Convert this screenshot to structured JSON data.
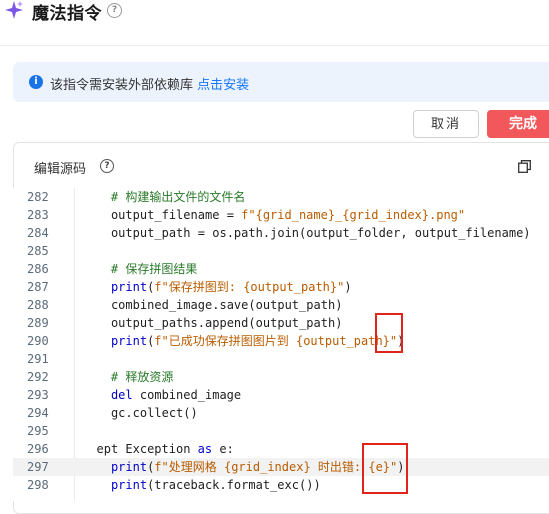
{
  "header": {
    "title": "魔法指令",
    "help": "?"
  },
  "banner": {
    "text": "该指令需安装外部依赖库",
    "link": "点击安装",
    "icon": "i"
  },
  "buttons": {
    "cancel": "取消",
    "done": "完成"
  },
  "editor": {
    "title": "编辑源码",
    "help": "?"
  },
  "code_lines": [
    {
      "n": "282",
      "text": "    # 构建输出文件的文件名"
    },
    {
      "n": "283",
      "text": "    output_filename = f\"{grid_name}_{grid_index}.png\""
    },
    {
      "n": "284",
      "text": "    output_path = os.path.join(output_folder, output_filename)"
    },
    {
      "n": "285",
      "text": ""
    },
    {
      "n": "286",
      "text": "    # 保存拼图结果"
    },
    {
      "n": "287",
      "text": "    print(f\"保存拼图到: {output_path}\")"
    },
    {
      "n": "288",
      "text": "    combined_image.save(output_path)"
    },
    {
      "n": "289",
      "text": "    output_paths.append(output_path)"
    },
    {
      "n": "290",
      "text": "    print(f\"已成功保存拼图图片到 {output_path}\")"
    },
    {
      "n": "291",
      "text": ""
    },
    {
      "n": "292",
      "text": "    # 释放资源"
    },
    {
      "n": "293",
      "text": "    del combined_image"
    },
    {
      "n": "294",
      "text": "    gc.collect()"
    },
    {
      "n": "295",
      "text": ""
    },
    {
      "n": "296",
      "text": "  ept Exception as e:"
    },
    {
      "n": "297",
      "text": "    print(f\"处理网格 {grid_index} 时出错: {e}\")"
    },
    {
      "n": "298",
      "text": "    print(traceback.format_exc())"
    }
  ],
  "colors": {
    "accent": "#f2575c",
    "link": "#1677ff",
    "banner_bg": "#ecf3fd",
    "keyword": "#0000c8",
    "string": "#b85c00",
    "comment": "#2a7a2a",
    "annotation_box": "#e0241b"
  },
  "icons": {
    "title_icon": "sparkle-icon",
    "info": "info-icon",
    "copy": "copy-icon"
  }
}
